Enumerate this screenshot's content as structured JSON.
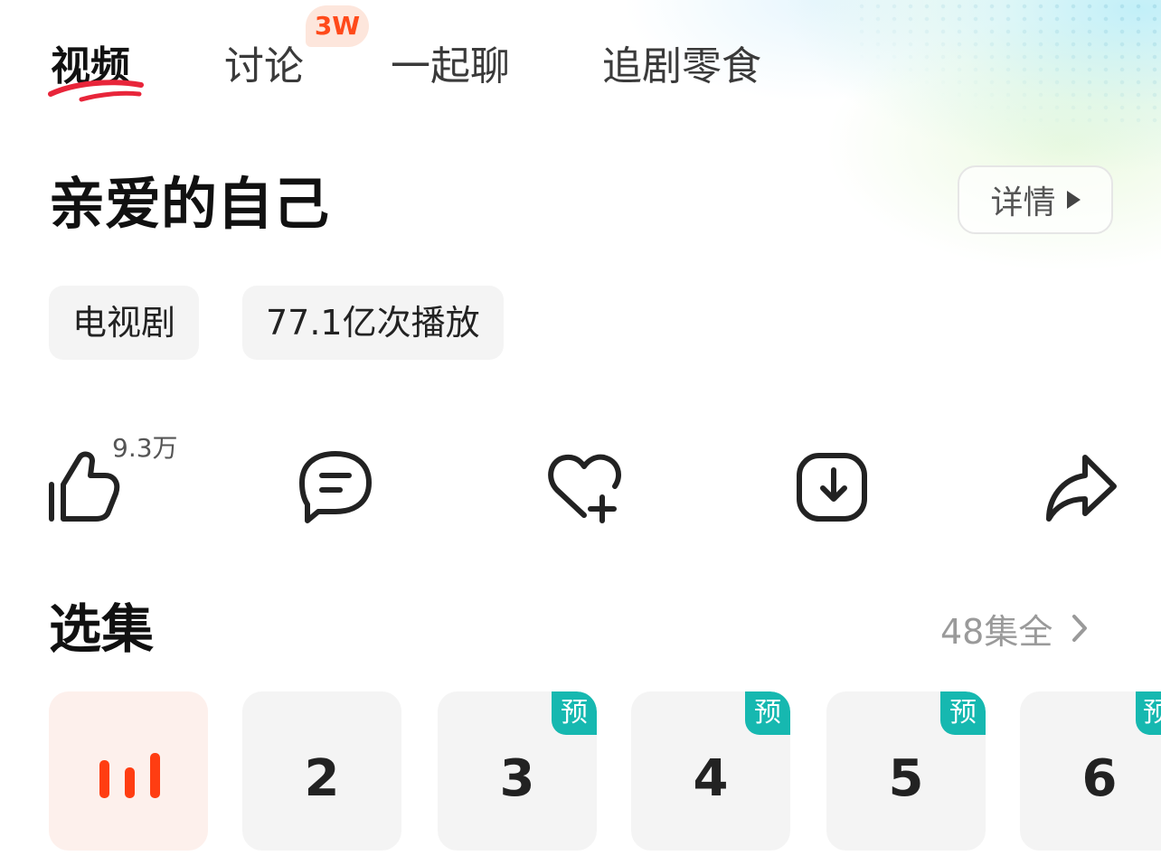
{
  "tabs": [
    {
      "label": "视频",
      "active": true
    },
    {
      "label": "讨论",
      "active": false,
      "badge": "3W"
    },
    {
      "label": "一起聊",
      "active": false
    },
    {
      "label": "追剧零食",
      "active": false
    }
  ],
  "show": {
    "title": "亲爱的自己",
    "detail_label": "详情",
    "tags": [
      "电视剧",
      "77.1亿次播放"
    ]
  },
  "actions": {
    "like_count": "9.3万",
    "icons": [
      "thumb-up-icon",
      "comment-icon",
      "heart-plus-icon",
      "download-icon",
      "share-icon"
    ]
  },
  "episodes": {
    "section_title": "选集",
    "total_label": "48集全",
    "items": [
      {
        "number": "",
        "playing": true,
        "badge": ""
      },
      {
        "number": "2",
        "playing": false,
        "badge": ""
      },
      {
        "number": "3",
        "playing": false,
        "badge": "预"
      },
      {
        "number": "4",
        "playing": false,
        "badge": "预"
      },
      {
        "number": "5",
        "playing": false,
        "badge": "预"
      },
      {
        "number": "6",
        "playing": false,
        "badge": "预"
      }
    ]
  },
  "colors": {
    "accent": "#ff3d12",
    "badge_teal": "#16b8b0",
    "tab_badge_bg": "#fde6dc",
    "tab_badge_text": "#ff4a1a"
  }
}
